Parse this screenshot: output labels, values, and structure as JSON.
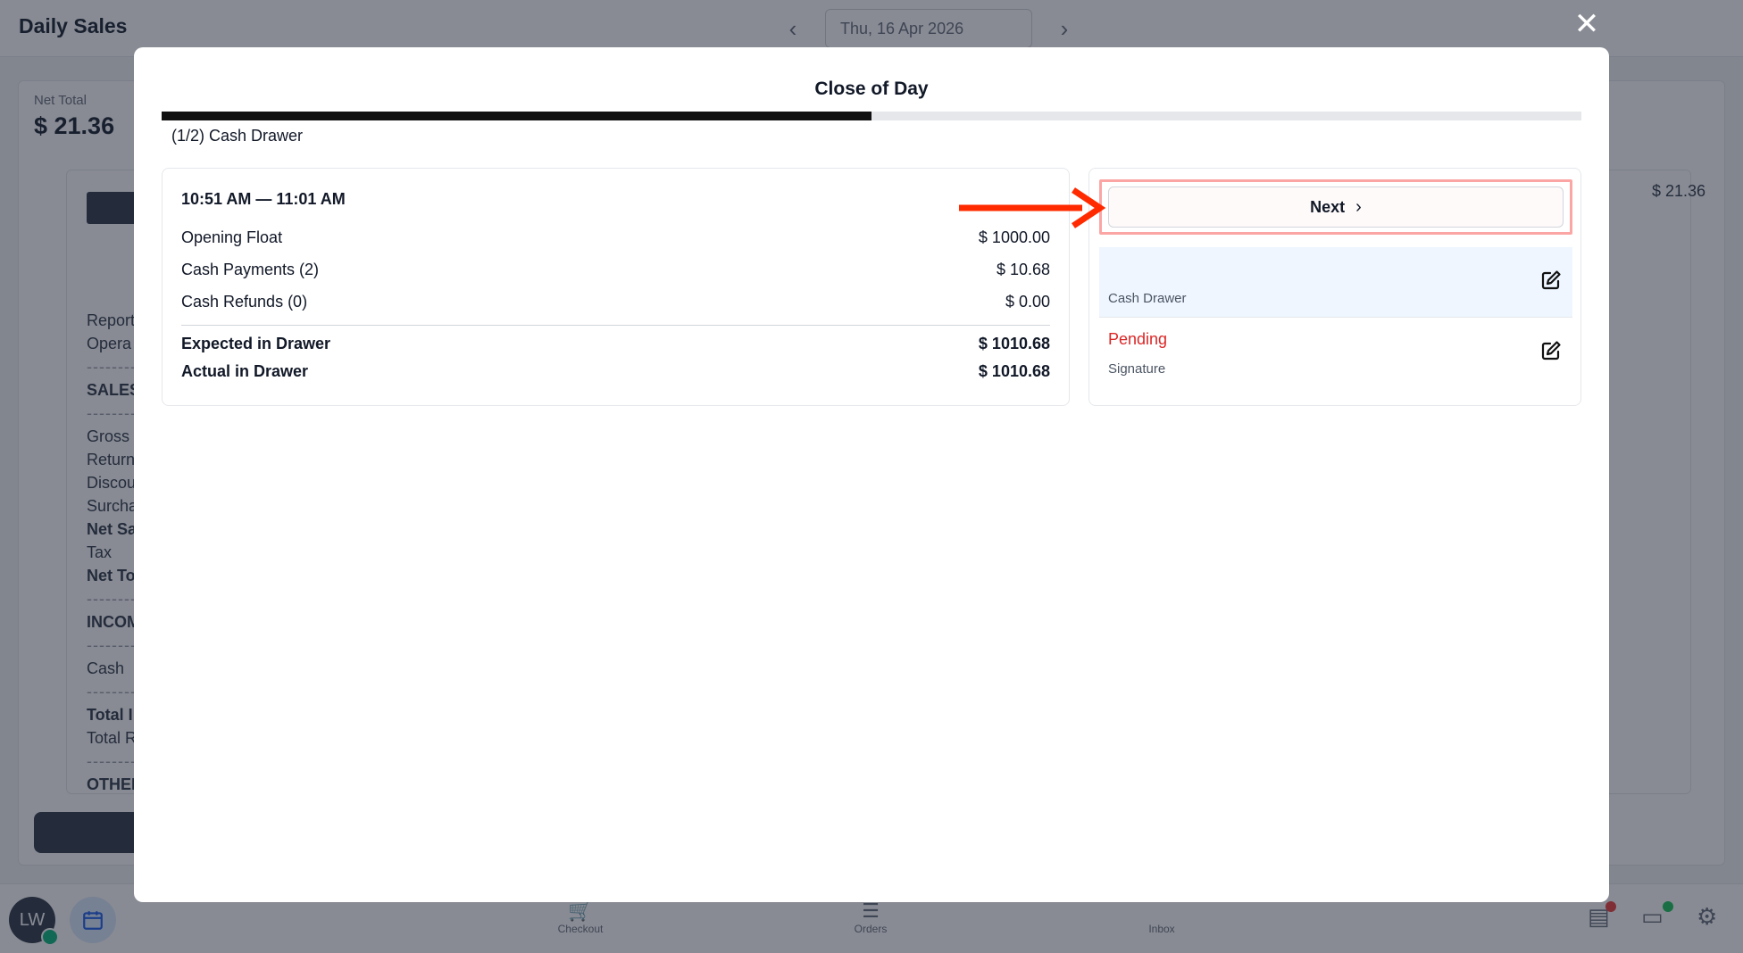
{
  "app": {
    "title": "Daily Sales",
    "date": "Thu, 16 Apr 2026",
    "net_total_label": "Net Total",
    "net_total_value": "$ 21.36",
    "right_amount": "$ 21.36",
    "report_lines": [
      "Report",
      "Opera",
      "SALES",
      "Gross",
      "Return",
      "Discou",
      "Surcha",
      "Net Sa",
      "Tax",
      "Net To",
      "INCOM",
      "Cash",
      "Total I",
      "Total R",
      "OTHEI"
    ]
  },
  "bottom_bar": {
    "avatar_initials": "LW",
    "tabs": [
      {
        "label": "Checkout",
        "icon": "cart-icon"
      },
      {
        "label": "Orders",
        "icon": "orders-icon"
      },
      {
        "label": "Inbox",
        "icon": "inbox-icon"
      }
    ]
  },
  "modal": {
    "title": "Close of Day",
    "progress": 0.5,
    "step_label": "(1/2) Cash Drawer",
    "time_range": "10:51 AM — 11:01 AM",
    "rows": [
      {
        "label": "Opening Float",
        "value": "$ 1000.00"
      },
      {
        "label": "Cash Payments (2)",
        "value": "$ 10.68"
      },
      {
        "label": "Cash Refunds (0)",
        "value": "$ 0.00"
      }
    ],
    "totals": [
      {
        "label": "Expected in Drawer",
        "value": "$ 1010.68"
      },
      {
        "label": "Actual in Drawer",
        "value": "$ 1010.68"
      }
    ],
    "next_label": "Next",
    "steps": [
      {
        "status": "",
        "name": "Cash Drawer"
      },
      {
        "status": "Pending",
        "name": "Signature"
      }
    ]
  },
  "colors": {
    "accent": "#111111",
    "pending": "#dc2626",
    "highlight": "#fca5a5",
    "arrow": "#ff2a00"
  }
}
